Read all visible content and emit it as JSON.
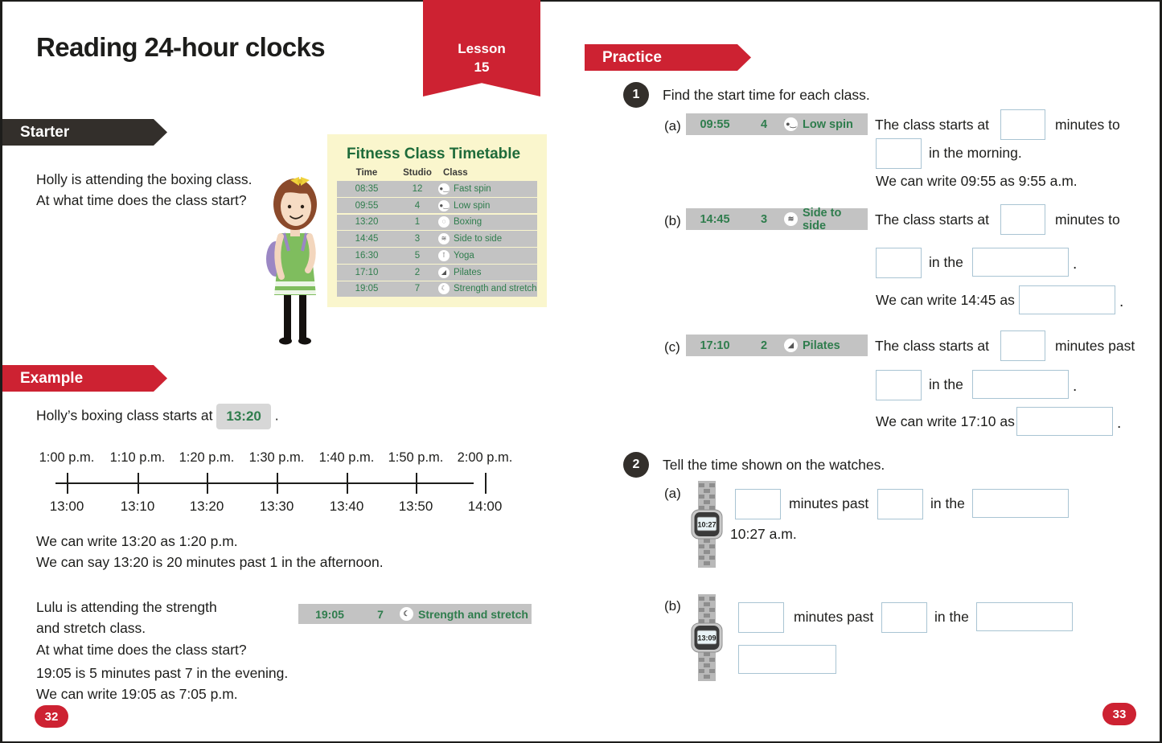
{
  "page": {
    "title": "Reading 24-hour clocks",
    "lesson_label": "Lesson",
    "lesson_number": "15",
    "page_number_left": "32",
    "page_number_right": "33",
    "accent_red": "#cd2232",
    "dark": "#332f2b",
    "green": "#2f7d4d",
    "answer_box_border": "#a9c4d3",
    "chip_grey": "#c3c3c3",
    "timetable_bg": "#faf6cd"
  },
  "starter": {
    "banner": "Starter",
    "line1": "Holly is attending the boxing class.",
    "line2": "At what time does the class start?"
  },
  "timetable": {
    "title": "Fitness Class Timetable",
    "headers": [
      "Time",
      "Studio",
      "Class"
    ],
    "rows": [
      {
        "time": "08:35",
        "studio": "12",
        "class": "Fast spin",
        "icon": "spin-bike-icon",
        "glyph": "Ὣ2"
      },
      {
        "time": "09:55",
        "studio": "4",
        "class": "Low spin",
        "icon": "spin-bike-icon",
        "glyph": "Ὣ2"
      },
      {
        "time": "13:20",
        "studio": "1",
        "class": "Boxing",
        "icon": "boxing-glove-icon",
        "glyph": "○"
      },
      {
        "time": "14:45",
        "studio": "3",
        "class": "Side to side",
        "icon": "side-to-side-icon",
        "glyph": "≋"
      },
      {
        "time": "16:30",
        "studio": "5",
        "class": "Yoga",
        "icon": "yoga-pose-icon",
        "glyph": "¥"
      },
      {
        "time": "17:10",
        "studio": "2",
        "class": "Pilates",
        "icon": "pilates-mat-icon",
        "glyph": "◢"
      },
      {
        "time": "19:05",
        "studio": "7",
        "class": "Strength and stretch",
        "icon": "stretch-icon",
        "glyph": "☾"
      }
    ]
  },
  "example": {
    "banner": "Example",
    "intro_before": "Holly’s boxing class starts at",
    "intro_chip": "13:20",
    "intro_after": ".",
    "timeline": {
      "top_labels": [
        "1:00 p.m.",
        "1:10 p.m.",
        "1:20 p.m.",
        "1:30 p.m.",
        "1:40 p.m.",
        "1:50 p.m.",
        "2:00 p.m."
      ],
      "bottom_labels": [
        "13:00",
        "13:10",
        "13:20",
        "13:30",
        "13:40",
        "13:50",
        "14:00"
      ]
    },
    "note1": "We can write 13:20 as 1:20 p.m.",
    "note2": "We can say 13:20 is 20 minutes past 1 in the afternoon.",
    "lulu_line1": "Lulu is attending the strength",
    "lulu_line2": "and stretch class.",
    "lulu_line3": "At what time does the class start?",
    "lulu_row": {
      "time": "19:05",
      "studio": "7",
      "class": "Strength and stretch",
      "icon": "stretch-icon",
      "glyph": "☾"
    },
    "lulu_note1": "19:05 is 5 minutes past 7 in the evening.",
    "lulu_note2": "We can write 19:05 as 7:05 p.m."
  },
  "practice": {
    "banner": "Practice",
    "q1": {
      "number": "1",
      "prompt": "Find the start time for each class.",
      "items": [
        {
          "letter": "(a)",
          "row": {
            "time": "09:55",
            "studio": "4",
            "class": "Low spin",
            "icon": "spin-bike-icon",
            "glyph": "Ὣ2"
          },
          "lead": "The class starts at",
          "connector": "minutes to",
          "tail": "in the morning.",
          "note": "We can write 09:55 as 9:55 a.m."
        },
        {
          "letter": "(b)",
          "row": {
            "time": "14:45",
            "studio": "3",
            "class": "Side to side",
            "icon": "side-to-side-icon",
            "glyph": "≋"
          },
          "lead": "The class starts at",
          "connector": "minutes to",
          "tail": "in the",
          "note_lead": "We can write 14:45 as"
        },
        {
          "letter": "(c)",
          "row": {
            "time": "17:10",
            "studio": "2",
            "class": "Pilates",
            "icon": "pilates-mat-icon",
            "glyph": "◢"
          },
          "lead": "The class starts at",
          "connector": "minutes past",
          "tail": "in the",
          "note_lead": "We can write 17:10 as"
        }
      ]
    },
    "q2": {
      "number": "2",
      "prompt": "Tell the time shown on the watches.",
      "items": [
        {
          "letter": "(a)",
          "watch_time": "10:27",
          "connector1": "minutes past",
          "connector2": "in the",
          "answer_shown": "10:27 a.m."
        },
        {
          "letter": "(b)",
          "watch_time": "13:09",
          "connector1": "minutes past",
          "connector2": "in the"
        }
      ]
    }
  }
}
